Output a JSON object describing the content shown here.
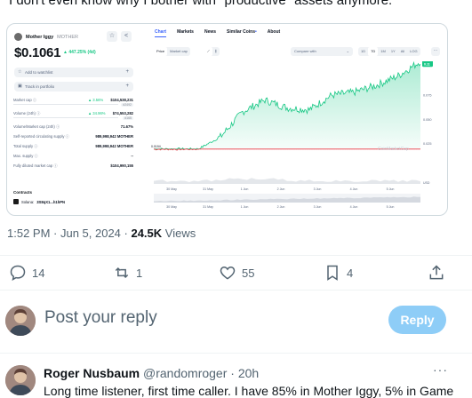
{
  "tweet": {
    "text": "I don't even know why I bother with \"productive\" assets anymore.",
    "meta_time": "1:52 PM · Jun 5, 2024 · ",
    "views_count": "24.5K",
    "views_label": " Views"
  },
  "card": {
    "coin": {
      "name": "Mother Iggy",
      "symbol": "MOTHER",
      "price": "$0.1061",
      "change": "▲ 447.25% (4d)"
    },
    "buttons": {
      "watchlist": "Add to watchlist",
      "portfolio": "Track in portfolio"
    },
    "stats": [
      {
        "key": "Market cap ⓘ",
        "change": "▲ 3.56%",
        "value": "$104,538,231",
        "sub": "#2492"
      },
      {
        "key": "Volume (24h) ⓘ",
        "change": "▲ 34.96%",
        "value": "$74,553,282",
        "sub": "#165"
      },
      {
        "key": "Volume/Market cap (24h) ⓘ",
        "change": "",
        "value": "71.67%",
        "sub": ""
      },
      {
        "key": "Self-reported circulating supply ⓘ",
        "change": "",
        "value": "989,998,942 MOTHER",
        "sub": ""
      },
      {
        "key": "Total supply ⓘ",
        "change": "",
        "value": "989,998,942 MOTHER",
        "sub": ""
      },
      {
        "key": "Max. supply ⓘ",
        "change": "",
        "value": "--",
        "sub": ""
      },
      {
        "key": "Fully diluted market cap ⓘ",
        "change": "",
        "value": "$104,990,155",
        "sub": ""
      }
    ],
    "contracts": {
      "heading": "Contracts",
      "chain": "Solana:",
      "address": "3S8qX1...h1hPN"
    },
    "tabs": [
      "Chart",
      "Markets",
      "News",
      "Similar Coins",
      "About"
    ],
    "toggle": [
      "Price",
      "Market cap"
    ],
    "compare": "Compare with",
    "ranges": [
      "1D",
      "7D",
      "1M",
      "1Y",
      "All",
      "LOG"
    ],
    "watermark": "CoinMarketCap",
    "price_tag": "0.11",
    "volume_tag": "USD"
  },
  "chart_data": {
    "type": "line",
    "x": [
      "30 May",
      "31 May",
      "1 Jun",
      "2 Jun",
      "3 Jun",
      "4 Jun",
      "5 Jun"
    ],
    "series": [
      {
        "values": [
          0.0194,
          0.0194,
          0.0194,
          0.032,
          0.058,
          0.07,
          0.062,
          0.06,
          0.075,
          0.078,
          0.085,
          0.095,
          0.11
        ]
      }
    ],
    "y_ticks": [
      "0.075",
      "0.050",
      "0.025"
    ],
    "start_label": "0.0194",
    "baseline": 0.0194,
    "ylim": [
      0,
      0.11
    ],
    "nav_x": [
      "30 May",
      "31 May",
      "1 Jun",
      "2 Jun",
      "3 Jun",
      "4 Jun",
      "5 Jun"
    ],
    "colors": {
      "up": "#16c784",
      "down": "#ea3943"
    }
  },
  "actions": {
    "replies": "14",
    "retweets": "1",
    "likes": "55",
    "bookmarks": "4"
  },
  "reply_box": {
    "placeholder": "Post your reply",
    "button": "Reply"
  },
  "reply": {
    "name": "Roger Nusbaum",
    "handle": "@randomroger",
    "time": "· 20h",
    "text": "Long time listener, first time caller. I have 85% in Mother Iggy, 5% in Game"
  }
}
